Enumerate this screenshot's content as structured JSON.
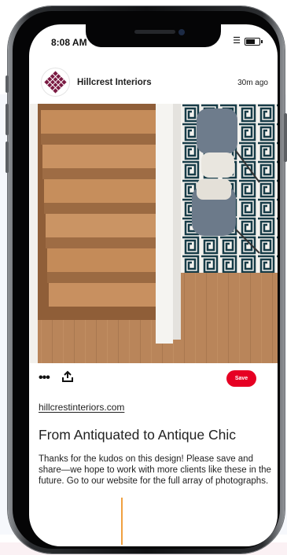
{
  "status_bar": {
    "time": "8:08 AM",
    "wifi_icon": "wifi-icon",
    "battery_icon": "battery-icon"
  },
  "post": {
    "account_name": "Hillcrest Interiors",
    "time_ago": "30m ago",
    "source_link": "hillcrestinteriors.com",
    "title": "From Antiquated to Antique Chic",
    "description": "Thanks for the kudos on this design! Please save and share—we hope to work with more clients like these in the future. Go to our website for the full array of photographs."
  },
  "actions": {
    "more_icon": "more-icon",
    "share_icon": "share-icon",
    "save_label": "Save"
  },
  "colors": {
    "save_button": "#e60023",
    "avatar_mark": "#7a1a42",
    "callout_line": "#f0a040"
  }
}
